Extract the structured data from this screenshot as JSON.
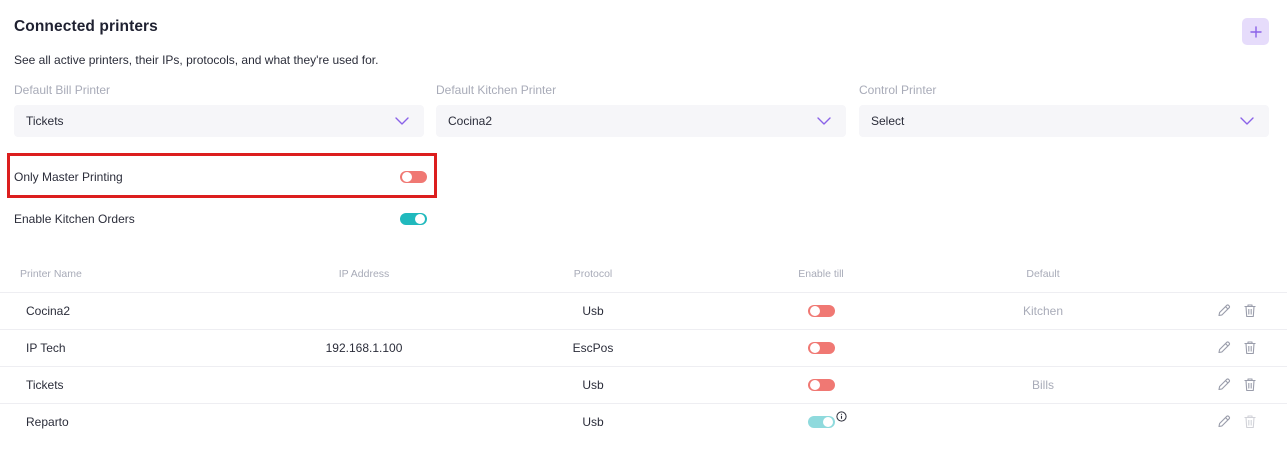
{
  "header": {
    "title": "Connected printers",
    "subtitle": "See all active printers, their IPs, protocols, and what they're used for."
  },
  "selects": [
    {
      "label": "Default Bill Printer",
      "value": "Tickets"
    },
    {
      "label": "Default Kitchen Printer",
      "value": "Cocina2"
    },
    {
      "label": "Control Printer",
      "value": "Select"
    }
  ],
  "toggles": {
    "only_master_printing": {
      "label": "Only Master Printing",
      "state": "off"
    },
    "enable_kitchen_orders": {
      "label": "Enable Kitchen Orders",
      "state": "on"
    }
  },
  "table": {
    "headers": [
      "Printer Name",
      "IP Address",
      "Protocol",
      "Enable till",
      "Default"
    ],
    "rows": [
      {
        "name": "Cocina2",
        "ip": "",
        "protocol": "Usb",
        "enable_till": "off",
        "default": "Kitchen"
      },
      {
        "name": "IP Tech",
        "ip": "192.168.1.100",
        "protocol": "EscPos",
        "enable_till": "off",
        "default": ""
      },
      {
        "name": "Tickets",
        "ip": "",
        "protocol": "Usb",
        "enable_till": "off",
        "default": "Bills"
      },
      {
        "name": "Reparto",
        "ip": "",
        "protocol": "Usb",
        "enable_till": "on",
        "default": ""
      }
    ]
  },
  "colors": {
    "accent": "#8a62e8",
    "toggle_off": "#f07873",
    "toggle_on": "#20b9bd",
    "highlight_border": "#dc1e1e"
  },
  "icons": [
    "plus-icon",
    "chevron-down-icon",
    "info-icon",
    "edit-icon",
    "trash-icon"
  ]
}
